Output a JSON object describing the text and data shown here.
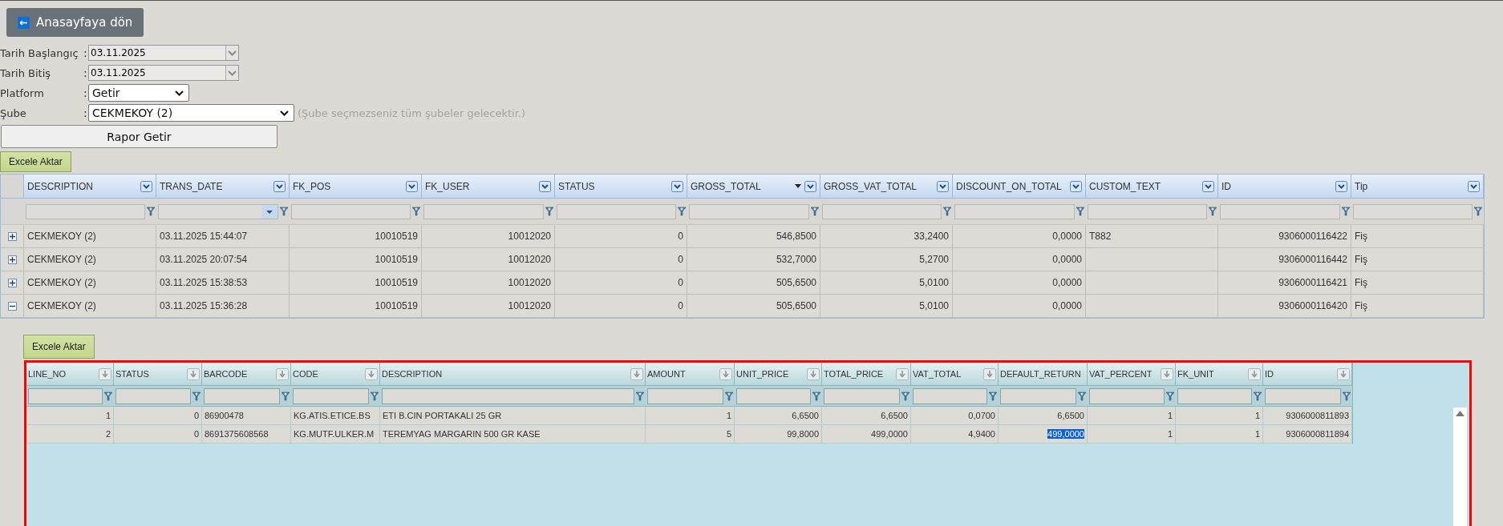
{
  "back_button": {
    "label": "Anasayfaya dön"
  },
  "filters": [
    {
      "kind": "date",
      "label": "Tarih Başlangıç",
      "value": "03.11.2025",
      "disabled": true
    },
    {
      "kind": "date",
      "label": "Tarih Bitiş",
      "value": "03.11.2025",
      "disabled": true
    },
    {
      "kind": "select",
      "label": "Platform",
      "value": "Getir",
      "disabled": false
    },
    {
      "kind": "select",
      "label": "Şube",
      "value": "CEKMEKOY (2)",
      "disabled": false,
      "hint": "(Şube seçmezseniz tüm şubeler gelecektir.)"
    }
  ],
  "separator": ":",
  "report_button": {
    "label": "Rapor Getir"
  },
  "export_button": {
    "label": "Excele Aktar"
  },
  "main_grid": {
    "columns": [
      {
        "label": "DESCRIPTION",
        "kind": "text",
        "sorted_descending": false,
        "filter_dropdown": false
      },
      {
        "label": "TRANS_DATE",
        "kind": "text",
        "sorted_descending": false,
        "filter_dropdown": true
      },
      {
        "label": "FK_POS",
        "kind": "number",
        "sorted_descending": false,
        "filter_dropdown": false
      },
      {
        "label": "FK_USER",
        "kind": "number",
        "sorted_descending": false,
        "filter_dropdown": false
      },
      {
        "label": "STATUS",
        "kind": "number",
        "sorted_descending": false,
        "filter_dropdown": false
      },
      {
        "label": "GROSS_TOTAL",
        "kind": "number",
        "sorted_descending": true,
        "filter_dropdown": false
      },
      {
        "label": "GROSS_VAT_TOTAL",
        "kind": "number",
        "sorted_descending": false,
        "filter_dropdown": false
      },
      {
        "label": "DISCOUNT_ON_TOTAL",
        "kind": "number",
        "sorted_descending": false,
        "filter_dropdown": false
      },
      {
        "label": "CUSTOM_TEXT",
        "kind": "text",
        "sorted_descending": false,
        "filter_dropdown": false
      },
      {
        "label": "ID",
        "kind": "number",
        "sorted_descending": false,
        "filter_dropdown": false
      },
      {
        "label": "Tip",
        "kind": "text",
        "sorted_descending": false,
        "filter_dropdown": false
      }
    ],
    "rows": [
      {
        "expanded": false,
        "cells": [
          "CEKMEKOY (2)",
          "03.11.2025 15:44:07",
          "10010519",
          "10012020",
          "0",
          "546,8500",
          "33,2400",
          "0,0000",
          "T882",
          "9306000116422",
          "Fiş"
        ]
      },
      {
        "expanded": false,
        "cells": [
          "CEKMEKOY (2)",
          "03.11.2025 20:07:54",
          "10010519",
          "10012020",
          "0",
          "532,7000",
          "5,2700",
          "0,0000",
          "",
          "9306000116442",
          "Fiş"
        ]
      },
      {
        "expanded": false,
        "cells": [
          "CEKMEKOY (2)",
          "03.11.2025 15:38:53",
          "10010519",
          "10012020",
          "0",
          "505,6500",
          "5,0100",
          "0,0000",
          "",
          "9306000116421",
          "Fiş"
        ]
      },
      {
        "expanded": true,
        "cells": [
          "CEKMEKOY (2)",
          "03.11.2025 15:36:28",
          "10010519",
          "10012020",
          "0",
          "505,6500",
          "5,0100",
          "0,0000",
          "",
          "9306000116420",
          "Fiş"
        ]
      }
    ]
  },
  "detail": {
    "export_button": {
      "label": "Excele Aktar"
    },
    "columns": [
      {
        "label": "LINE_NO",
        "kind": "number"
      },
      {
        "label": "STATUS",
        "kind": "number"
      },
      {
        "label": "BARCODE",
        "kind": "text"
      },
      {
        "label": "CODE",
        "kind": "text"
      },
      {
        "label": "DESCRIPTION",
        "kind": "text"
      },
      {
        "label": "AMOUNT",
        "kind": "number"
      },
      {
        "label": "UNIT_PRICE",
        "kind": "number"
      },
      {
        "label": "TOTAL_PRICE",
        "kind": "number"
      },
      {
        "label": "VAT_TOTAL",
        "kind": "number"
      },
      {
        "label": "DEFAULT_RETURN",
        "kind": "number"
      },
      {
        "label": "VAT_PERCENT",
        "kind": "number"
      },
      {
        "label": "FK_UNIT",
        "kind": "number"
      },
      {
        "label": "ID",
        "kind": "number"
      }
    ],
    "rows": [
      {
        "cells": [
          {
            "text": "1",
            "selected": false
          },
          {
            "text": "0",
            "selected": false
          },
          {
            "text": "86900478",
            "selected": false
          },
          {
            "text": "KG.ATIS.ETICE.BS",
            "selected": false
          },
          {
            "text": "ETI B.CIN PORTAKALI 25 GR",
            "selected": false
          },
          {
            "text": "1",
            "selected": false
          },
          {
            "text": "6,6500",
            "selected": false
          },
          {
            "text": "6,6500",
            "selected": false
          },
          {
            "text": "0,0700",
            "selected": false
          },
          {
            "text": "6,6500",
            "selected": false
          },
          {
            "text": "1",
            "selected": false
          },
          {
            "text": "1",
            "selected": false
          },
          {
            "text": "9306000811893",
            "selected": false
          }
        ]
      },
      {
        "cells": [
          {
            "text": "2",
            "selected": false
          },
          {
            "text": "0",
            "selected": false
          },
          {
            "text": "8691375608568",
            "selected": false
          },
          {
            "text": "KG.MUTF.ULKER.M",
            "selected": false
          },
          {
            "text": "TEREMYAG MARGARIN 500 GR KASE",
            "selected": false
          },
          {
            "text": "5",
            "selected": false
          },
          {
            "text": "99,8000",
            "selected": false
          },
          {
            "text": "499,0000",
            "selected": false
          },
          {
            "text": "4,9400",
            "selected": false
          },
          {
            "text": "499,0000",
            "selected": true
          },
          {
            "text": "1",
            "selected": false
          },
          {
            "text": "1",
            "selected": false
          },
          {
            "text": "9306000811894",
            "selected": false
          }
        ]
      }
    ]
  }
}
